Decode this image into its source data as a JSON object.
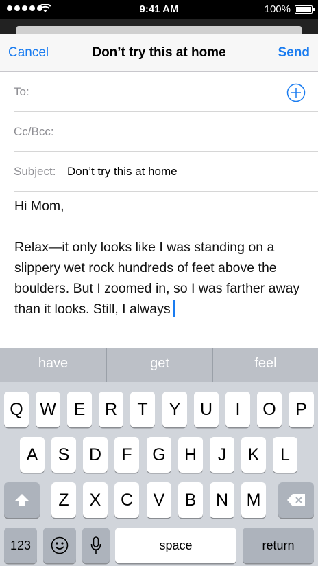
{
  "status": {
    "time": "9:41 AM",
    "battery": "100%",
    "battery_level": 1.0
  },
  "nav": {
    "cancel": "Cancel",
    "title": "Don’t try this at home",
    "send": "Send"
  },
  "fields": {
    "to_label": "To:",
    "ccbcc_label": "Cc/Bcc:",
    "subject_label": "Subject:",
    "subject_value": "Don’t try this at home"
  },
  "body": {
    "greeting": "Hi Mom,",
    "message": "Relax—it only looks like I was standing on a slippery wet rock hundreds of feet above the boulders. But I zoomed in, so I was farther away than it looks. Still, I always"
  },
  "predictions": [
    "have",
    "get",
    "feel"
  ],
  "keyboard": {
    "row1": [
      "Q",
      "W",
      "E",
      "R",
      "T",
      "Y",
      "U",
      "I",
      "O",
      "P"
    ],
    "row2": [
      "A",
      "S",
      "D",
      "F",
      "G",
      "H",
      "J",
      "K",
      "L"
    ],
    "row3": [
      "Z",
      "X",
      "C",
      "V",
      "B",
      "N",
      "M"
    ],
    "numbers": "123",
    "space": "space",
    "return": "return"
  },
  "icons": {
    "shift": "shift-icon",
    "delete": "backspace-icon",
    "emoji": "emoji-icon",
    "mic": "microphone-icon",
    "add": "add-contact-icon",
    "wifi": "wifi-icon"
  },
  "colors": {
    "accent": "#1a7cf0"
  }
}
